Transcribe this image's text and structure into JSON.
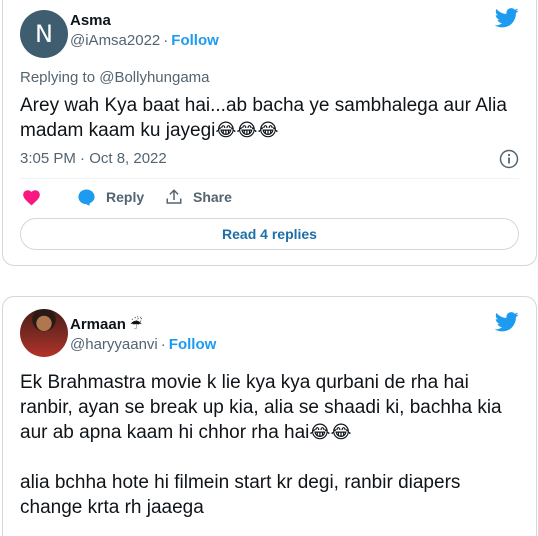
{
  "tweet1": {
    "avatar_letter": "N",
    "name": "Asma",
    "handle": "@iAmsa2022",
    "separator": "·",
    "follow": "Follow",
    "replying_to": "Replying to @Bollyhungama",
    "text_line1": "Arey wah Kya baat hai...ab bacha ye sambhalega aur Alia",
    "text_line2": "madam kaam ku jayegi",
    "emojis": "😂😂😂",
    "timestamp": "3:05 PM · Oct 8, 2022",
    "reply_label": "Reply",
    "share_label": "Share",
    "read_replies": "Read 4 replies"
  },
  "tweet2": {
    "name": "Armaan",
    "name_emoji": "☔",
    "handle": "@haryyaanvi",
    "separator": "·",
    "follow": "Follow",
    "text_line1": "Ek Brahmastra movie k lie kya kya qurbani de rha hai",
    "text_line2": "ranbir, ayan se break up kia, alia se shaadi ki, bachha kia",
    "text_line3": "aur ab apna kaam hi chhor rha hai",
    "text_line3_emojis": "😂😂",
    "text_line4": "alia bchha hote hi filmein start kr degi, ranbir diapers",
    "text_line5": "change krta rh jaaega"
  },
  "colors": {
    "accent": "#1d9bf0",
    "heart": "#f91880",
    "secondary_text": "#536471"
  },
  "icons": [
    "twitter-bird-icon",
    "info-icon",
    "heart-icon",
    "reply-bubble-icon",
    "share-icon",
    "umbrella-icon"
  ]
}
